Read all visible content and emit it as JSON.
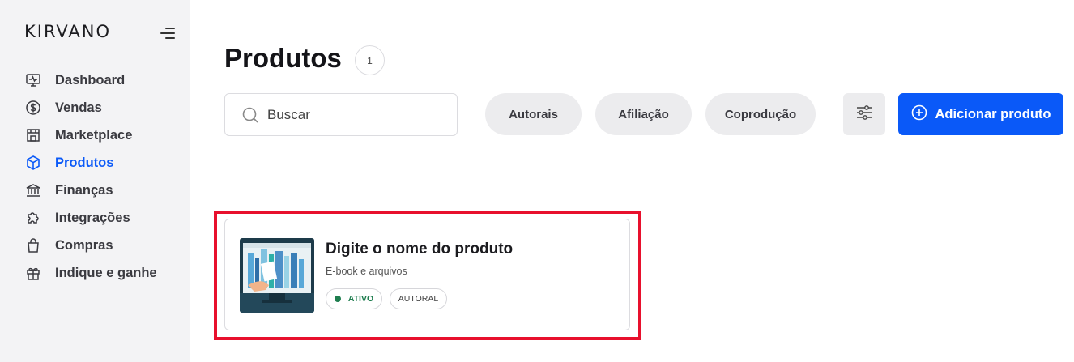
{
  "brand": {
    "logo": "KIRVANO"
  },
  "sidebar": {
    "items": [
      {
        "label": "Dashboard",
        "icon": "monitor-pulse-icon",
        "active": false
      },
      {
        "label": "Vendas",
        "icon": "dollar-circle-icon",
        "active": false
      },
      {
        "label": "Marketplace",
        "icon": "store-icon",
        "active": false
      },
      {
        "label": "Produtos",
        "icon": "box-icon",
        "active": true
      },
      {
        "label": "Finanças",
        "icon": "bank-icon",
        "active": false
      },
      {
        "label": "Integrações",
        "icon": "puzzle-icon",
        "active": false
      },
      {
        "label": "Compras",
        "icon": "shopping-bag-icon",
        "active": false
      },
      {
        "label": "Indique e ganhe",
        "icon": "gift-icon",
        "active": false
      }
    ]
  },
  "header": {
    "title": "Produtos",
    "count": "1"
  },
  "toolbar": {
    "search_placeholder": "Buscar",
    "filters": [
      "Autorais",
      "Afiliação",
      "Coprodução"
    ],
    "add_label": "Adicionar produto"
  },
  "products": [
    {
      "name": "Digite o nome do produto",
      "type": "E-book e arquivos",
      "status": "ATIVO",
      "tag": "AUTORAL"
    }
  ],
  "colors": {
    "accent": "#0a59f8",
    "highlight": "#e8102d",
    "status_active": "#1e7d4e",
    "sidebar_bg": "#f3f3f5"
  }
}
